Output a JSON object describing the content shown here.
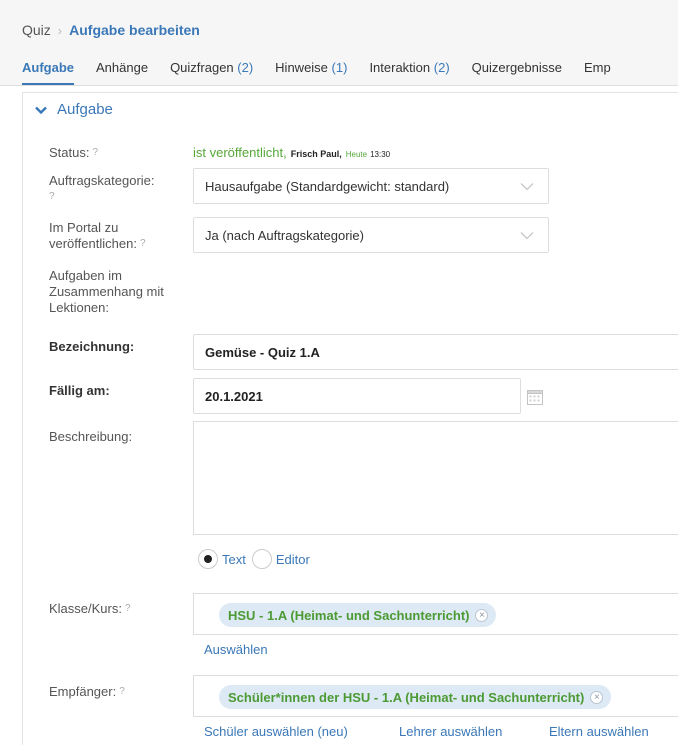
{
  "breadcrumb": {
    "root": "Quiz",
    "current": "Aufgabe bearbeiten"
  },
  "tabs": [
    {
      "label": "Aufgabe",
      "count": ""
    },
    {
      "label": "Anhänge",
      "count": ""
    },
    {
      "label": "Quizfragen",
      "count": "(2)"
    },
    {
      "label": "Hinweise",
      "count": "(1)"
    },
    {
      "label": "Interaktion",
      "count": "(2)"
    },
    {
      "label": "Quizergebnisse",
      "count": ""
    },
    {
      "label": "Emp",
      "count": ""
    }
  ],
  "section": {
    "title": "Aufgabe"
  },
  "form": {
    "status": {
      "label": "Status:",
      "value": "ist veröffentlicht,",
      "user": "Frisch Paul,",
      "today": "Heute",
      "time": "13:30"
    },
    "category": {
      "label": "Auftragskategorie:",
      "value": "Hausaufgabe (Standardgewicht: standard)"
    },
    "portal": {
      "label": "Im Portal zu veröffentlichen:",
      "value": "Ja (nach Auftragskategorie)"
    },
    "lessons": {
      "label": "Aufgaben im Zusammenhang mit Lektionen:"
    },
    "name": {
      "label": "Bezeichnung:",
      "value": "Gemüse - Quiz 1.A"
    },
    "due": {
      "label": "Fällig am:",
      "value": "20.1.2021"
    },
    "description": {
      "label": "Beschreibung:",
      "mode_text": "Text",
      "mode_editor": "Editor",
      "selected_mode": "Text"
    },
    "class": {
      "label": "Klasse/Kurs:",
      "tag": "HSU - 1.A (Heimat- und Sachunterricht)",
      "select_link": "Auswählen"
    },
    "recipients": {
      "label": "Empfänger:",
      "tag": "Schüler*innen der HSU - 1.A (Heimat- und Sachunterricht)",
      "students_link": "Schüler auswählen (neu)",
      "teachers_link": "Lehrer auswählen",
      "parents_link": "Eltern auswählen"
    }
  },
  "help_marker": "?",
  "colors": {
    "accent": "#3a78b8",
    "green": "#56a83a",
    "tag_bg": "#dde9f4"
  }
}
